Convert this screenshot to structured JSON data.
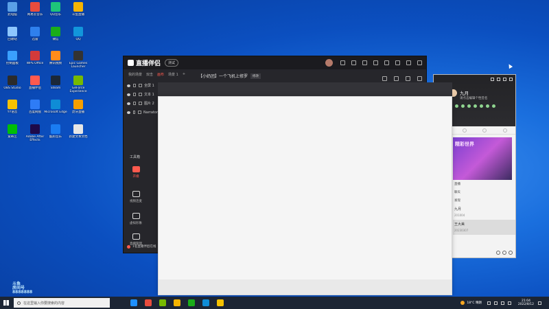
{
  "desktop": {
    "icons": [
      {
        "label": "此电脑",
        "color": "#5aa0e6"
      },
      {
        "label": "网易云音乐",
        "color": "#e84c3d"
      },
      {
        "label": "QQ音乐",
        "color": "#1ec47a"
      },
      {
        "label": "斗鱼直播",
        "color": "#f5b400"
      },
      {
        "label": "回收站",
        "color": "#8dc6ff"
      },
      {
        "label": "迅雷",
        "color": "#2f80ed"
      },
      {
        "label": "微信",
        "color": "#1aad19"
      },
      {
        "label": "QQ",
        "color": "#1296db"
      },
      {
        "label": "控制面板",
        "color": "#3aa0ff"
      },
      {
        "label": "WPS Office",
        "color": "#d23a3a"
      },
      {
        "label": "腾讯视频",
        "color": "#ff8c1a"
      },
      {
        "label": "Epic Games Launcher",
        "color": "#333333"
      },
      {
        "label": "OBS Studio",
        "color": "#2b2b2b"
      },
      {
        "label": "直播伴侣",
        "color": "#ff5a4e"
      },
      {
        "label": "Steam",
        "color": "#1b2838"
      },
      {
        "label": "GeForce Experience",
        "color": "#76b900"
      },
      {
        "label": "YY语音",
        "color": "#f6c200"
      },
      {
        "label": "百度网盘",
        "color": "#2e7cf6"
      },
      {
        "label": "Microsoft Edge",
        "color": "#0f8cd6"
      },
      {
        "label": "虎牙直播",
        "color": "#f59f00"
      },
      {
        "label": "爱奇艺",
        "color": "#00be06"
      },
      {
        "label": "Adobe After Effects",
        "color": "#1d0a4a"
      },
      {
        "label": "酷狗音乐",
        "color": "#1a7cf2"
      },
      {
        "label": "新建文本文档",
        "color": "#e6e6e6"
      }
    ]
  },
  "live_window": {
    "app_name": "直播伴侣",
    "badge": "测试",
    "stream_title": "【小奶团】一个飞机上修罗",
    "edit_label": "修改",
    "scene_tabs": [
      "我的场景",
      "双击",
      "画布",
      "场景 1"
    ],
    "active_scene_index": 2,
    "add_scene": "+",
    "sources": [
      "全屏 1",
      "文本 1",
      "图片 2",
      "Narrator"
    ],
    "tools_title": "工具箱",
    "tools": [
      {
        "label": "开播",
        "icon": "record-icon",
        "active": true
      },
      {
        "label": "视频连麦",
        "icon": "video-call-icon",
        "active": false
      },
      {
        "label": "虚拟形象",
        "icon": "avatar-icon",
        "active": false
      },
      {
        "label": "直播管理",
        "icon": "manage-icon",
        "active": false
      }
    ],
    "footer_text": "1名直播伴侣在线"
  },
  "chat_window": {
    "name": "九月",
    "subtitle": "请点击编辑个性签名",
    "banner_text": "精彩世界",
    "list_items": [
      "直播",
      "聊天",
      "发现"
    ],
    "users": [
      {
        "name": "九月",
        "meta": "201004"
      },
      {
        "name": "王大美",
        "meta": "20230307"
      }
    ]
  },
  "taskbar": {
    "search_placeholder": "在这里输入你要搜索的内容",
    "weather": "18°C 晴朗",
    "time": "21:04",
    "date": "2022/8/12",
    "apps": [
      "#1e90ff",
      "#e84c3d",
      "#76b900",
      "#f5b400",
      "#1aad19",
      "#0f8cd6",
      "#f6c200"
    ]
  },
  "watermark": {
    "line1": "斗鱼",
    "line2": "房间号",
    "line3": "8888888"
  }
}
